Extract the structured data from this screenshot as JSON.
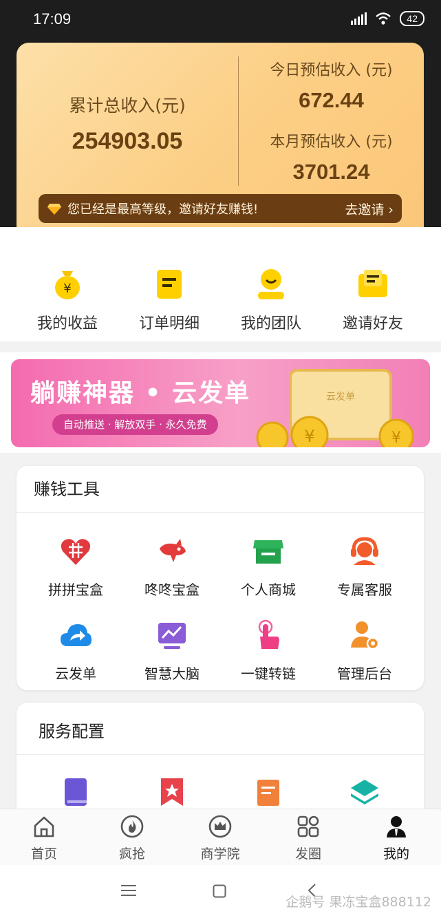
{
  "status_bar": {
    "time": "17:09",
    "battery": "42"
  },
  "earnings": {
    "total_label": "累计总收入(元)",
    "total_value": "254903.05",
    "today_label": "今日预估收入 (元)",
    "today_value": "672.44",
    "month_label": "本月预估收入 (元)",
    "month_value": "3701.24",
    "invite_message": "您已经是最高等级，邀请好友赚钱!",
    "invite_action": "去邀请"
  },
  "quick_actions": [
    {
      "label": "我的收益",
      "icon": "money-bag-icon"
    },
    {
      "label": "订单明细",
      "icon": "clipboard-icon"
    },
    {
      "label": "我的团队",
      "icon": "team-icon"
    },
    {
      "label": "邀请好友",
      "icon": "envelope-icon"
    }
  ],
  "banner": {
    "title": "躺赚神器 • 云发单",
    "subtitle": "自动推送 · 解放双手 · 永久免费",
    "doc_label": "云发单"
  },
  "earn_tools": {
    "title": "赚钱工具",
    "items": [
      {
        "label": "拼拼宝盒",
        "icon": "pinduoduo-heart-icon"
      },
      {
        "label": "咚咚宝盒",
        "icon": "jd-dog-icon"
      },
      {
        "label": "个人商城",
        "icon": "store-icon"
      },
      {
        "label": "专属客服",
        "icon": "customer-service-icon"
      },
      {
        "label": "云发单",
        "icon": "cloud-share-icon"
      },
      {
        "label": "智慧大脑",
        "icon": "chart-monitor-icon"
      },
      {
        "label": "一键转链",
        "icon": "tap-finger-icon"
      },
      {
        "label": "管理后台",
        "icon": "admin-gear-icon"
      }
    ]
  },
  "services": {
    "title": "服务配置",
    "items": [
      {
        "icon": "book-icon"
      },
      {
        "icon": "bookmark-star-icon"
      },
      {
        "icon": "scroll-icon"
      },
      {
        "icon": "layers-icon"
      }
    ]
  },
  "tabbar": [
    {
      "label": "首页",
      "icon": "home-icon"
    },
    {
      "label": "疯抢",
      "icon": "flame-icon"
    },
    {
      "label": "商学院",
      "icon": "crown-icon"
    },
    {
      "label": "发圈",
      "icon": "grid-icon"
    },
    {
      "label": "我的",
      "icon": "user-icon"
    }
  ],
  "watermark": "企鹅号 果冻宝盒888112",
  "colors": {
    "gold_card": "#fcd08a",
    "brown_text": "#6a4113",
    "banner_pink": "#f46bb0",
    "dark_header": "#1d1d1d"
  }
}
